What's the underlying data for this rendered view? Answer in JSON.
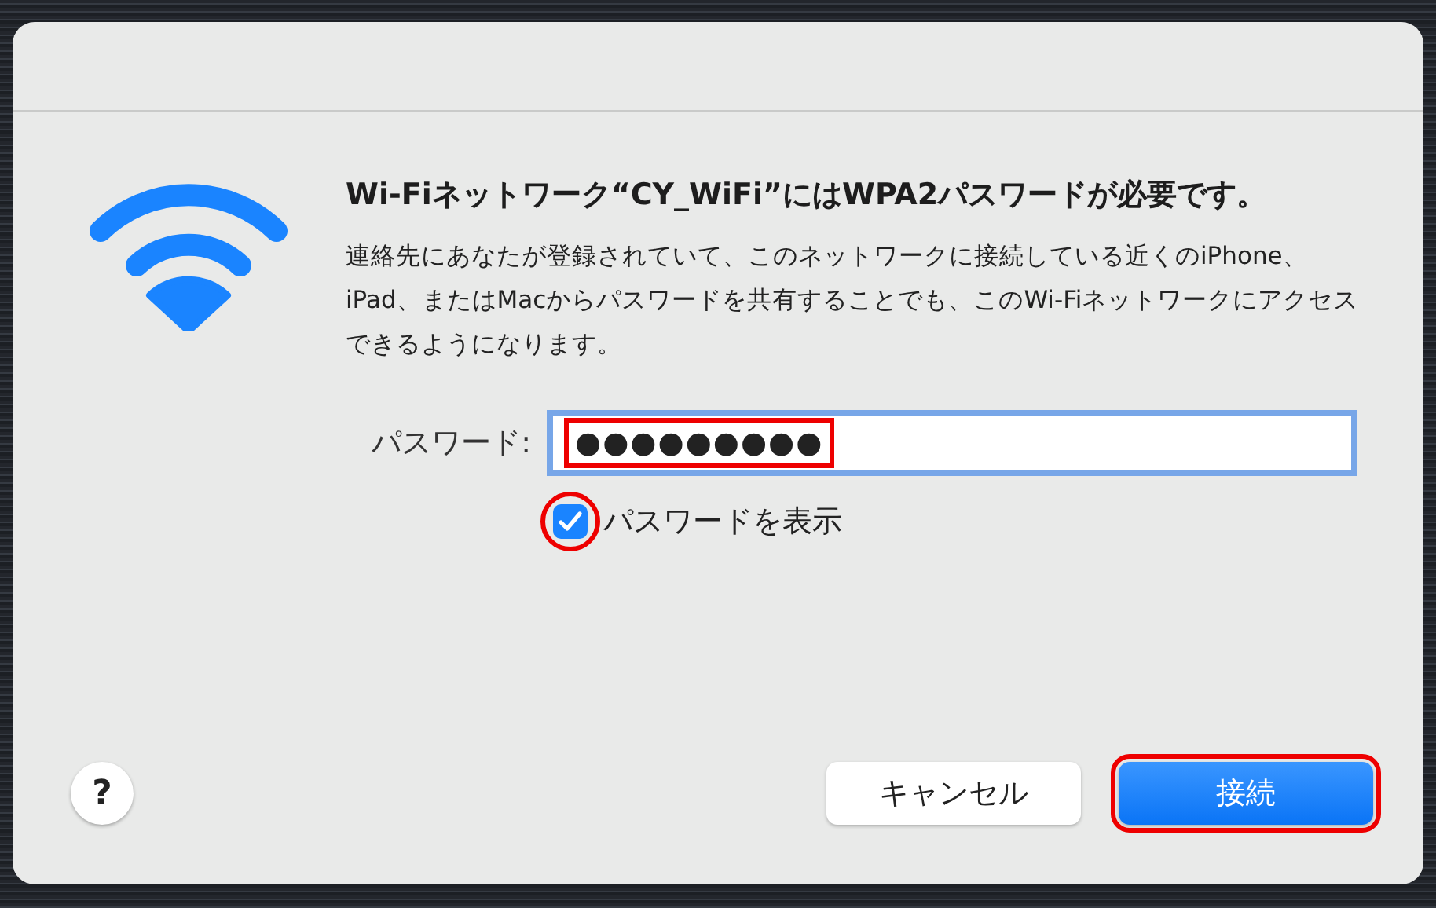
{
  "dialog": {
    "title": "Wi-Fiネットワーク“CY_WiFi”にはWPA2パスワードが必要です。",
    "message": "連絡先にあなたが登録されていて、このネットワークに接続している近くのiPhone、iPad、またはMacからパスワードを共有することでも、このWi-Fiネットワークにアクセスできるようになります。",
    "password": {
      "label": "パスワード:",
      "value": "●●●●●●●●●",
      "focused": true,
      "highlighted": true
    },
    "show_password": {
      "label": "パスワードを表示",
      "checked": true,
      "highlighted": true
    },
    "help_button": {
      "label": "?"
    },
    "buttons": [
      {
        "label": "キャンセル",
        "kind": "secondary",
        "highlighted": false
      },
      {
        "label": "接続",
        "kind": "primary",
        "highlighted": true
      }
    ]
  }
}
